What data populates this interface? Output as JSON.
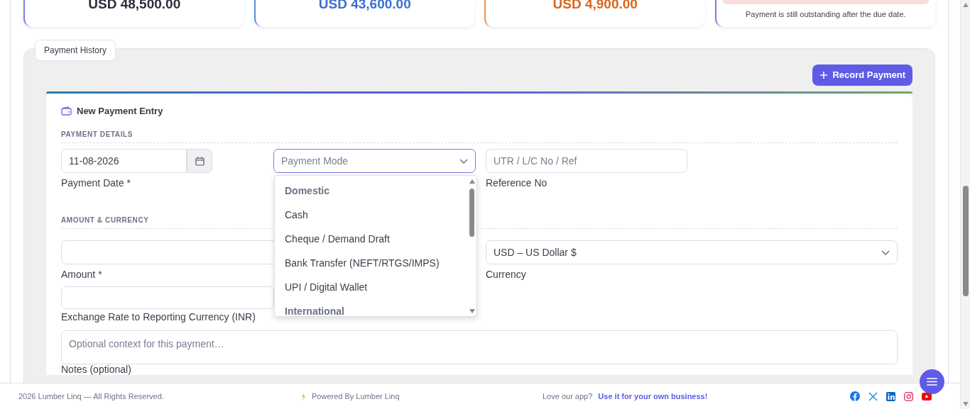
{
  "summary_cards": [
    {
      "kind": "total",
      "value": "USD 48,500.00",
      "color": "#2b2f3a"
    },
    {
      "kind": "paid",
      "value": "USD 43,600.00",
      "color": "#3b6fd1"
    },
    {
      "kind": "balance",
      "value": "USD 4,900.00",
      "color": "#d9661c"
    },
    {
      "kind": "alert",
      "note": "Payment is still outstanding after the due date.",
      "color": "#fbdcdc"
    }
  ],
  "section_tab": "Payment History",
  "record_button": "Record Payment",
  "form": {
    "title": "New Payment Entry",
    "sections": [
      {
        "heading": "PAYMENT DETAILS"
      },
      {
        "heading": "AMOUNT & CURRENCY"
      }
    ],
    "payment_date": {
      "value": "11-08-2026",
      "label": "Payment Date *"
    },
    "payment_mode": {
      "placeholder": "Payment Mode",
      "expanded": true,
      "options": [
        {
          "kind": "group",
          "label": "Domestic"
        },
        {
          "kind": "option",
          "label": "Cash",
          "selected": false
        },
        {
          "kind": "option",
          "label": "Cheque / Demand Draft",
          "selected": false
        },
        {
          "kind": "option",
          "label": "Bank Transfer (NEFT/RTGS/IMPS)",
          "selected": false
        },
        {
          "kind": "option",
          "label": "UPI / Digital Wallet",
          "selected": false
        },
        {
          "kind": "group",
          "label": "International"
        }
      ]
    },
    "reference": {
      "placeholder": "UTR / L/C No / Ref",
      "label": "Reference No"
    },
    "amount": {
      "label": "Amount *"
    },
    "currency": {
      "value": "USD – US Dollar $",
      "label": "Currency"
    },
    "exchange_rate": {
      "label": "Exchange Rate to Reporting Currency (INR)"
    },
    "notes": {
      "placeholder": "Optional context for this payment…",
      "label": "Notes (optional)"
    }
  },
  "footer": {
    "copyright": "2026 Lumber Linq — All Rights Reserved.",
    "powered_by": "Powered By Lumber Linq",
    "promo_text": "Love our app?",
    "promo_link": "Use it for your own business!"
  }
}
